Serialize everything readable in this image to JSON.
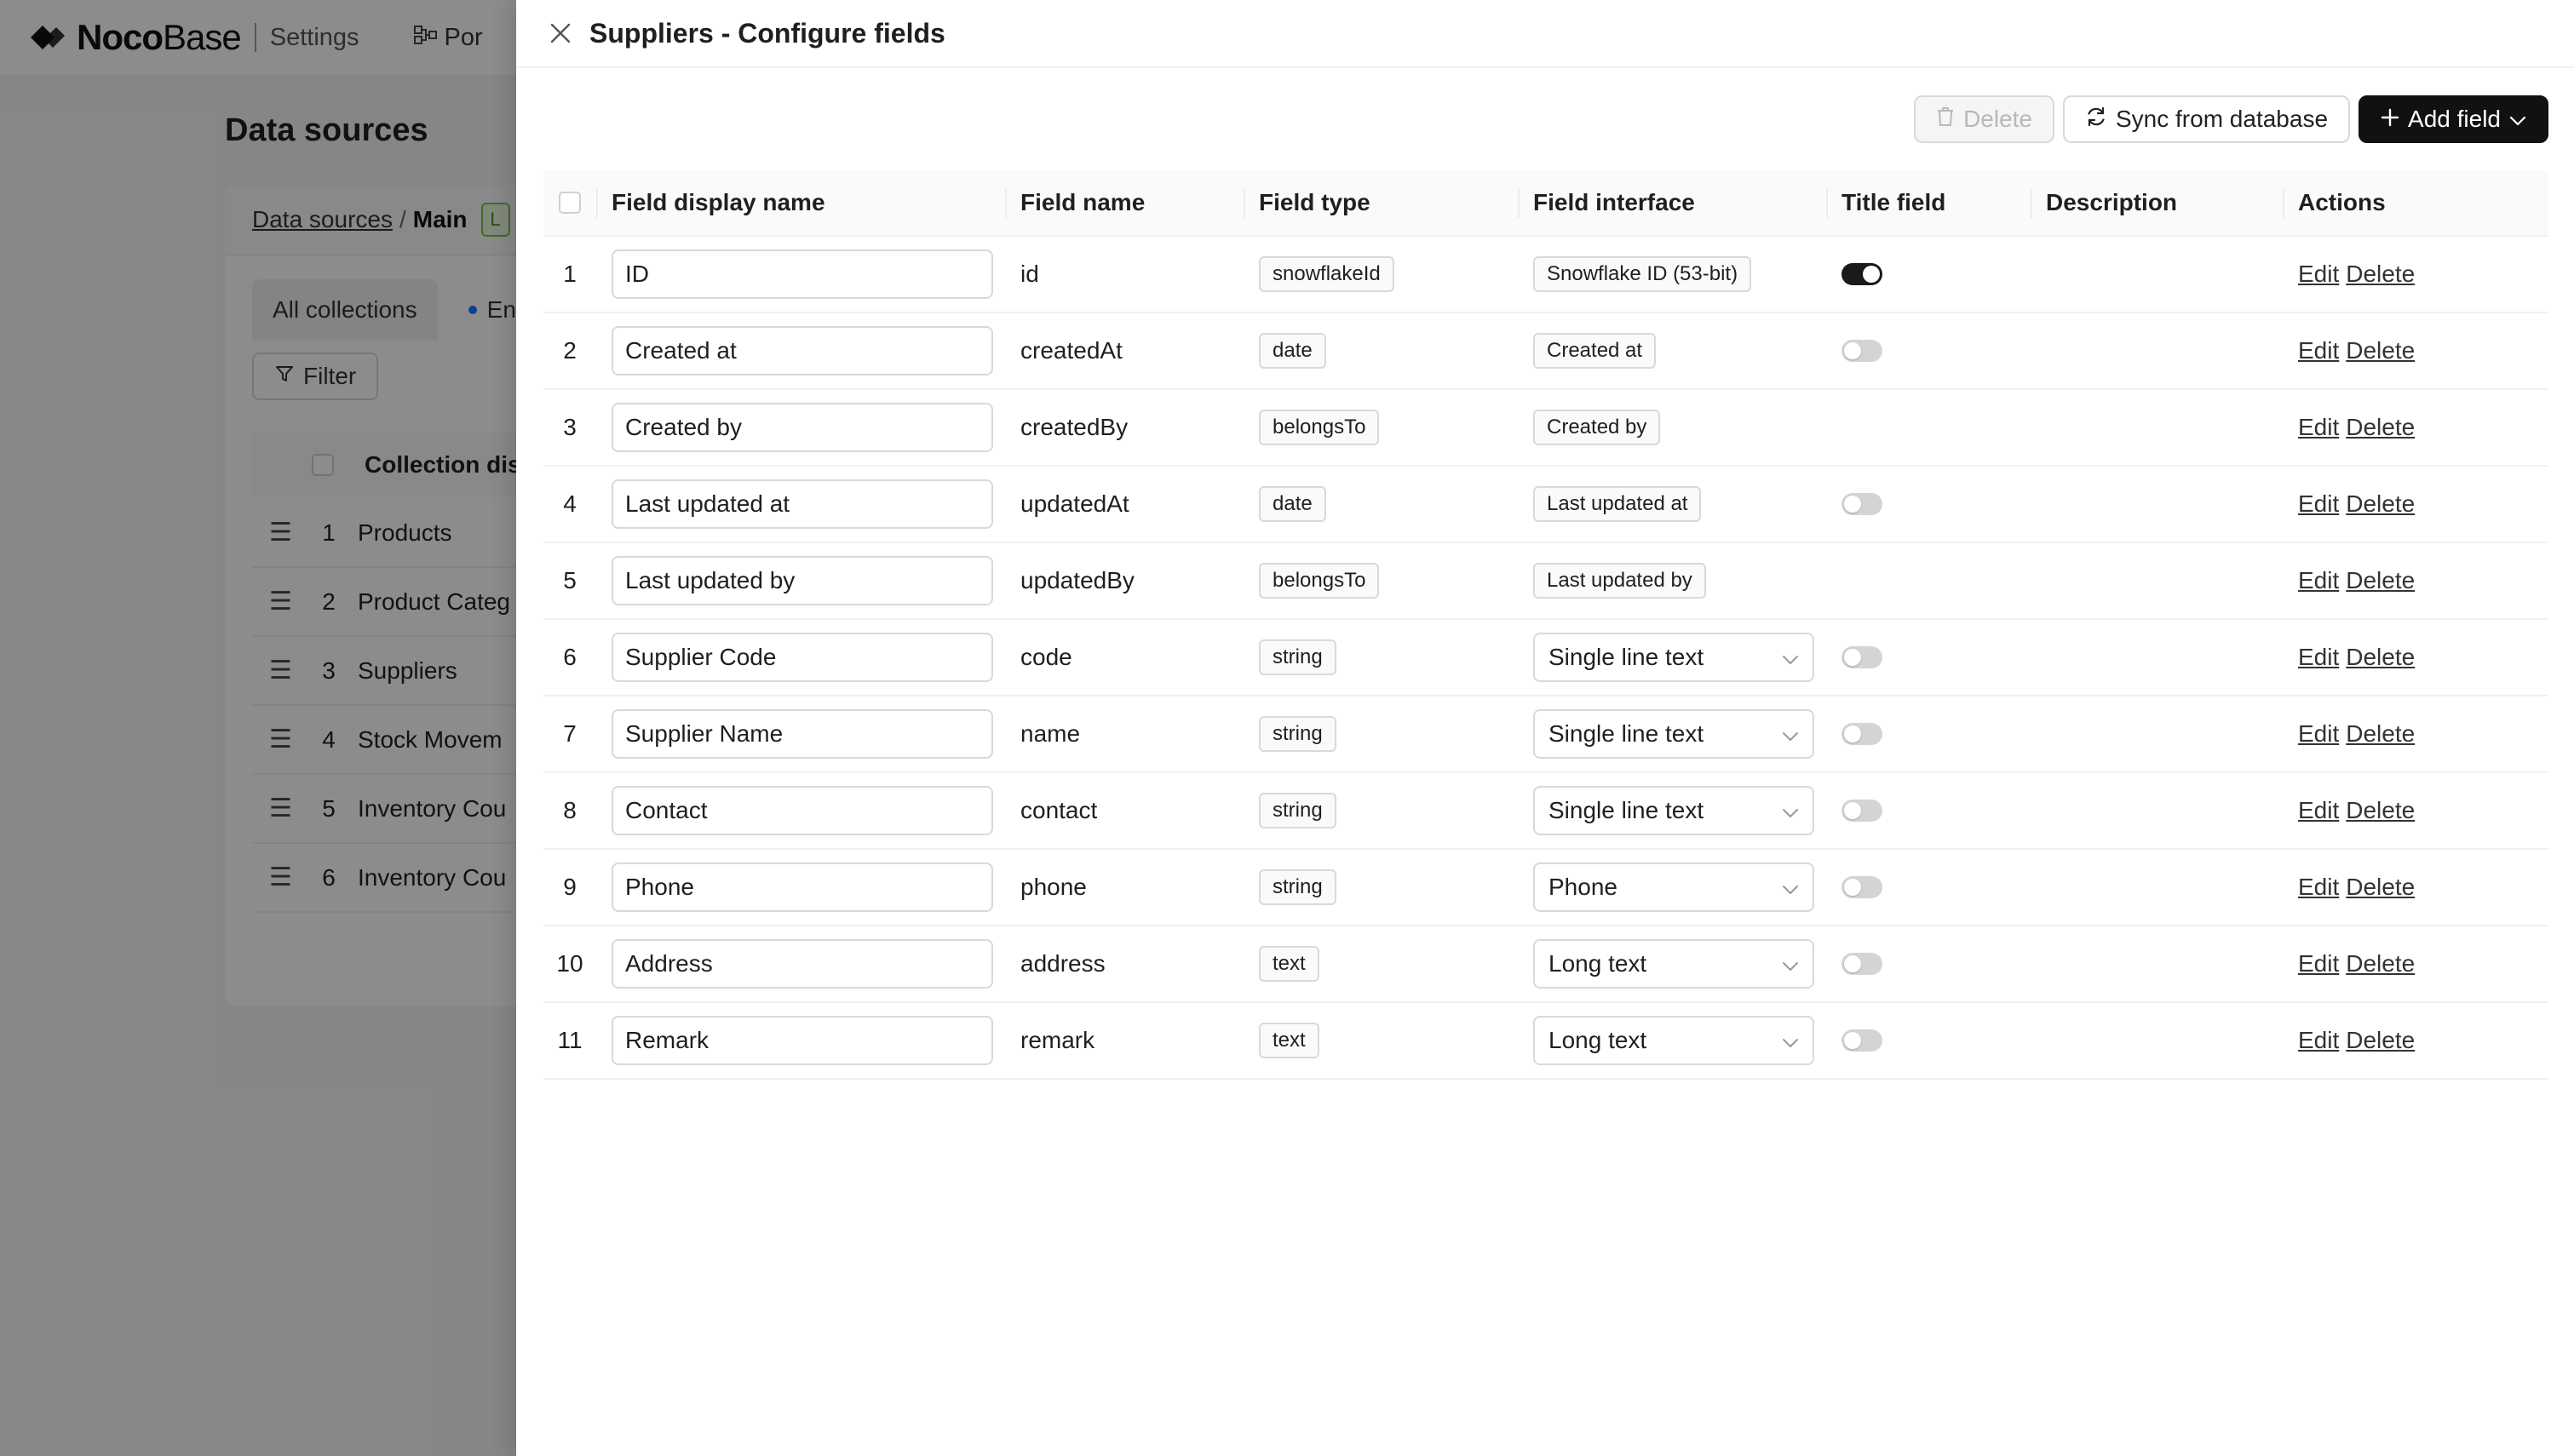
{
  "app": {
    "brand_bold": "Noco",
    "brand_light": "Base",
    "settings_label": "Settings",
    "menu_item_partial": "Por"
  },
  "background": {
    "page_title": "Data sources",
    "breadcrumb": {
      "root": "Data sources",
      "separator": "/",
      "current": "Main",
      "badge": "L"
    },
    "tabs": [
      "All collections",
      "Ente"
    ],
    "filter_label": "Filter",
    "table_header_partial": "Collection dis",
    "rows": [
      {
        "index": "1",
        "name": "Products"
      },
      {
        "index": "2",
        "name": "Product Categ"
      },
      {
        "index": "3",
        "name": "Suppliers"
      },
      {
        "index": "4",
        "name": "Stock Movem"
      },
      {
        "index": "5",
        "name": "Inventory Cou"
      },
      {
        "index": "6",
        "name": "Inventory Cou"
      }
    ]
  },
  "drawer": {
    "title": "Suppliers - Configure fields",
    "toolbar": {
      "delete_label": "Delete",
      "sync_label": "Sync from database",
      "add_label": "Add field"
    },
    "columns": [
      "Field display name",
      "Field name",
      "Field type",
      "Field interface",
      "Title field",
      "Description",
      "Actions"
    ],
    "action_edit": "Edit",
    "action_delete": "Delete",
    "rows": [
      {
        "index": "1",
        "display_name": "ID",
        "field_name": "id",
        "field_type": "snowflakeId",
        "interface": "Snowflake ID (53-bit)",
        "interface_kind": "tag",
        "title_field": "on"
      },
      {
        "index": "2",
        "display_name": "Created at",
        "field_name": "createdAt",
        "field_type": "date",
        "interface": "Created at",
        "interface_kind": "tag",
        "title_field": "off"
      },
      {
        "index": "3",
        "display_name": "Created by",
        "field_name": "createdBy",
        "field_type": "belongsTo",
        "interface": "Created by",
        "interface_kind": "tag",
        "title_field": "none"
      },
      {
        "index": "4",
        "display_name": "Last updated at",
        "field_name": "updatedAt",
        "field_type": "date",
        "interface": "Last updated at",
        "interface_kind": "tag",
        "title_field": "off"
      },
      {
        "index": "5",
        "display_name": "Last updated by",
        "field_name": "updatedBy",
        "field_type": "belongsTo",
        "interface": "Last updated by",
        "interface_kind": "tag",
        "title_field": "none"
      },
      {
        "index": "6",
        "display_name": "Supplier Code",
        "field_name": "code",
        "field_type": "string",
        "interface": "Single line text",
        "interface_kind": "select",
        "title_field": "off"
      },
      {
        "index": "7",
        "display_name": "Supplier Name",
        "field_name": "name",
        "field_type": "string",
        "interface": "Single line text",
        "interface_kind": "select",
        "title_field": "off"
      },
      {
        "index": "8",
        "display_name": "Contact",
        "field_name": "contact",
        "field_type": "string",
        "interface": "Single line text",
        "interface_kind": "select",
        "title_field": "off"
      },
      {
        "index": "9",
        "display_name": "Phone",
        "field_name": "phone",
        "field_type": "string",
        "interface": "Phone",
        "interface_kind": "select",
        "title_field": "off"
      },
      {
        "index": "10",
        "display_name": "Address",
        "field_name": "address",
        "field_type": "text",
        "interface": "Long text",
        "interface_kind": "select",
        "title_field": "off"
      },
      {
        "index": "11",
        "display_name": "Remark",
        "field_name": "remark",
        "field_type": "text",
        "interface": "Long text",
        "interface_kind": "select",
        "title_field": "off"
      }
    ]
  },
  "colors": {
    "primary_button": "#111111",
    "switch_on": "#1a1a1a",
    "switch_off": "#d4d4d4",
    "overlay": "rgba(0,0,0,0.45)"
  },
  "icons": {
    "close": "close-icon",
    "delete": "trash-icon",
    "sync": "sync-icon",
    "add": "plus-icon",
    "dropdown": "chevron-down-icon",
    "filter": "filter-icon",
    "drag": "drag-handle-icon"
  }
}
